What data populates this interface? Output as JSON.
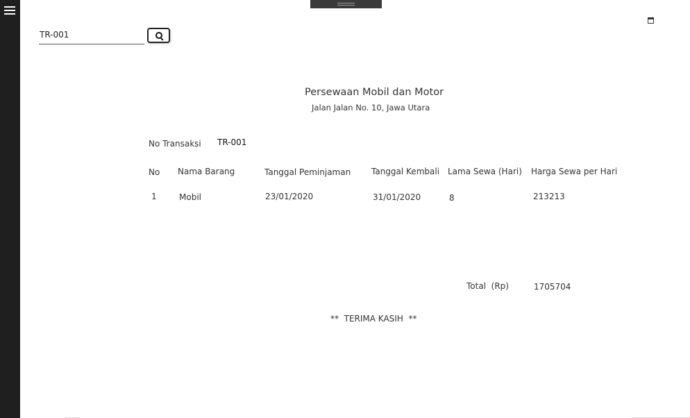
{
  "search": {
    "value": "TR-001"
  },
  "receipt": {
    "title": "Persewaan Mobil dan Motor",
    "address": "Jalan Jalan No. 10, Jawa Utara",
    "transaction_label": "No Transaksi",
    "transaction_value": "TR-001",
    "headers": [
      "No",
      "Nama Barang",
      "Tanggal Peminjaman",
      "Tanggal Kembali",
      "Lama Sewa (Hari)",
      "Harga Sewa per Hari"
    ],
    "rows": [
      [
        "1",
        "Mobil",
        "23/01/2020",
        "31/01/2020",
        "8",
        "213213"
      ]
    ],
    "total_label": "Total  (Rp)",
    "total_value": "1705704",
    "footer": "**  TERIMA KASIH  **"
  },
  "icons": [
    "menu-icon",
    "search-icon",
    "maximize-icon",
    "drag-handle"
  ]
}
